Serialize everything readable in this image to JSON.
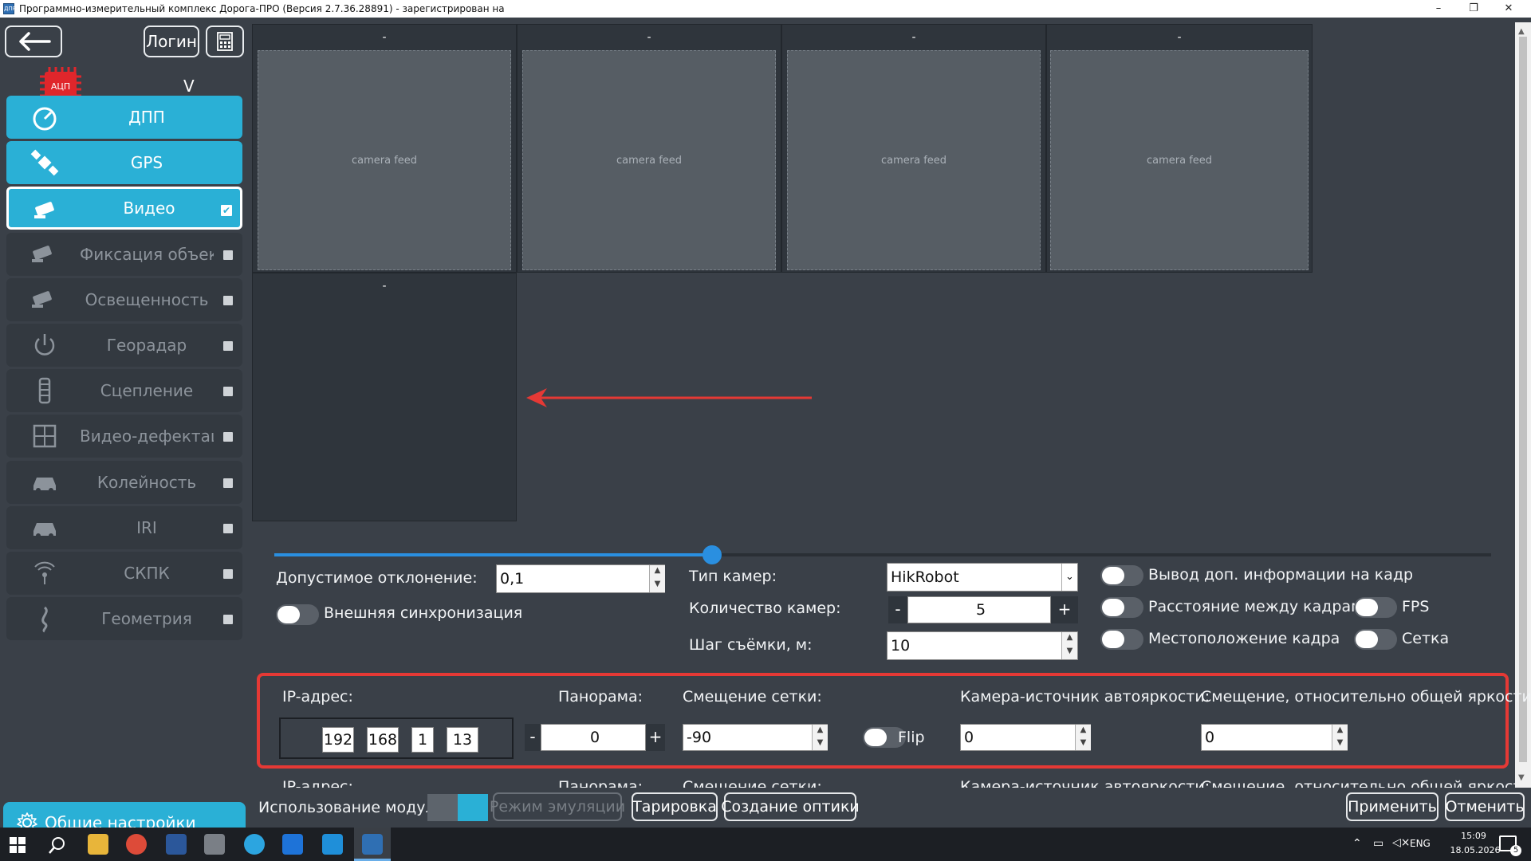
{
  "window": {
    "title": "Программно-измерительный комплекс Дорога-ПРО (Версия 2.7.36.28891) - зарегистрирован на",
    "app_icon": "ДПРО",
    "minimize": "–",
    "maximize": "❐",
    "close": "✕"
  },
  "sidebar": {
    "back_icon": "arrow-left-icon",
    "login_label": "Логин",
    "adc_label": "АЦП",
    "adc_status": "V",
    "items": [
      {
        "label": "ДПП",
        "icon": "speedometer-icon",
        "state": "active"
      },
      {
        "label": "GPS",
        "icon": "satellite-icon",
        "state": "active"
      },
      {
        "label": "Видео",
        "icon": "camera-icon",
        "state": "selected",
        "check": "✔"
      },
      {
        "label": "Фиксация объектов",
        "icon": "camera-icon",
        "state": "off"
      },
      {
        "label": "Освещенность",
        "icon": "camera-icon",
        "state": "off"
      },
      {
        "label": "Георадар",
        "icon": "power-icon",
        "state": "off"
      },
      {
        "label": "Сцепление",
        "icon": "tire-icon",
        "state": "off"
      },
      {
        "label": "Видео-дефектация",
        "icon": "grid-icon",
        "state": "off"
      },
      {
        "label": "Колейность",
        "icon": "car-icon",
        "state": "off"
      },
      {
        "label": "IRI",
        "icon": "car-icon",
        "state": "off"
      },
      {
        "label": "СКПК",
        "icon": "signal-icon",
        "state": "off"
      },
      {
        "label": "Геометрия",
        "icon": "curve-icon",
        "state": "off"
      }
    ],
    "general_settings": "Общие настройки"
  },
  "video_grid": {
    "cells": [
      {
        "title": "-",
        "feed": "camera feed"
      },
      {
        "title": "-",
        "feed": "camera feed"
      },
      {
        "title": "-",
        "feed": "camera feed"
      },
      {
        "title": "-",
        "feed": "camera feed"
      },
      {
        "title": "-",
        "feed": ""
      }
    ]
  },
  "slider": {
    "value_fraction": 0.36
  },
  "settings": {
    "tolerance_label": "Допустимое отклонение:",
    "tolerance_value": "0,1",
    "ext_sync_label": "Внешняя синхронизация",
    "camera_type_label": "Тип камер:",
    "camera_type_value": "HikRobot",
    "camera_count_label": "Количество камер:",
    "camera_count_value": "5",
    "minus": "-",
    "plus": "+",
    "shot_step_label": "Шаг съёмки, м:",
    "shot_step_value": "10",
    "overlay_info_label": "Вывод доп. информации на кадр",
    "frame_distance_label": "Расстояние между кадрами",
    "fps_label": "FPS",
    "frame_location_label": "Местоположение кадра",
    "grid_label": "Сетка"
  },
  "camera_row": {
    "ip_label": "IP-адрес:",
    "ip": [
      "192",
      "168",
      "1",
      "13"
    ],
    "panorama_label": "Панорама:",
    "panorama_value": "0",
    "grid_offset_label": "Смещение сетки:",
    "grid_offset_value": "-90",
    "flip_label": "Flip",
    "autobright_label": "Камера-источник автояркости:",
    "autobright_value": "0",
    "bright_offset_label": "Смещение, относительно общей яркости:",
    "bright_offset_value": "0"
  },
  "bottom": {
    "use_module_label": "Использование модуля",
    "emulation": "Режим эмуляции",
    "calibration": "Тарировка",
    "create_optics": "Создание оптики",
    "apply": "Применить",
    "cancel": "Отменить"
  },
  "taskbar": {
    "lang": "ENG",
    "time": "15:09",
    "date": "18.05.2026",
    "notifications": "5"
  },
  "colors": {
    "accent": "#2ab0d6",
    "background": "#3a4048",
    "highlight_border": "#e53935",
    "arrow": "#e53935"
  }
}
